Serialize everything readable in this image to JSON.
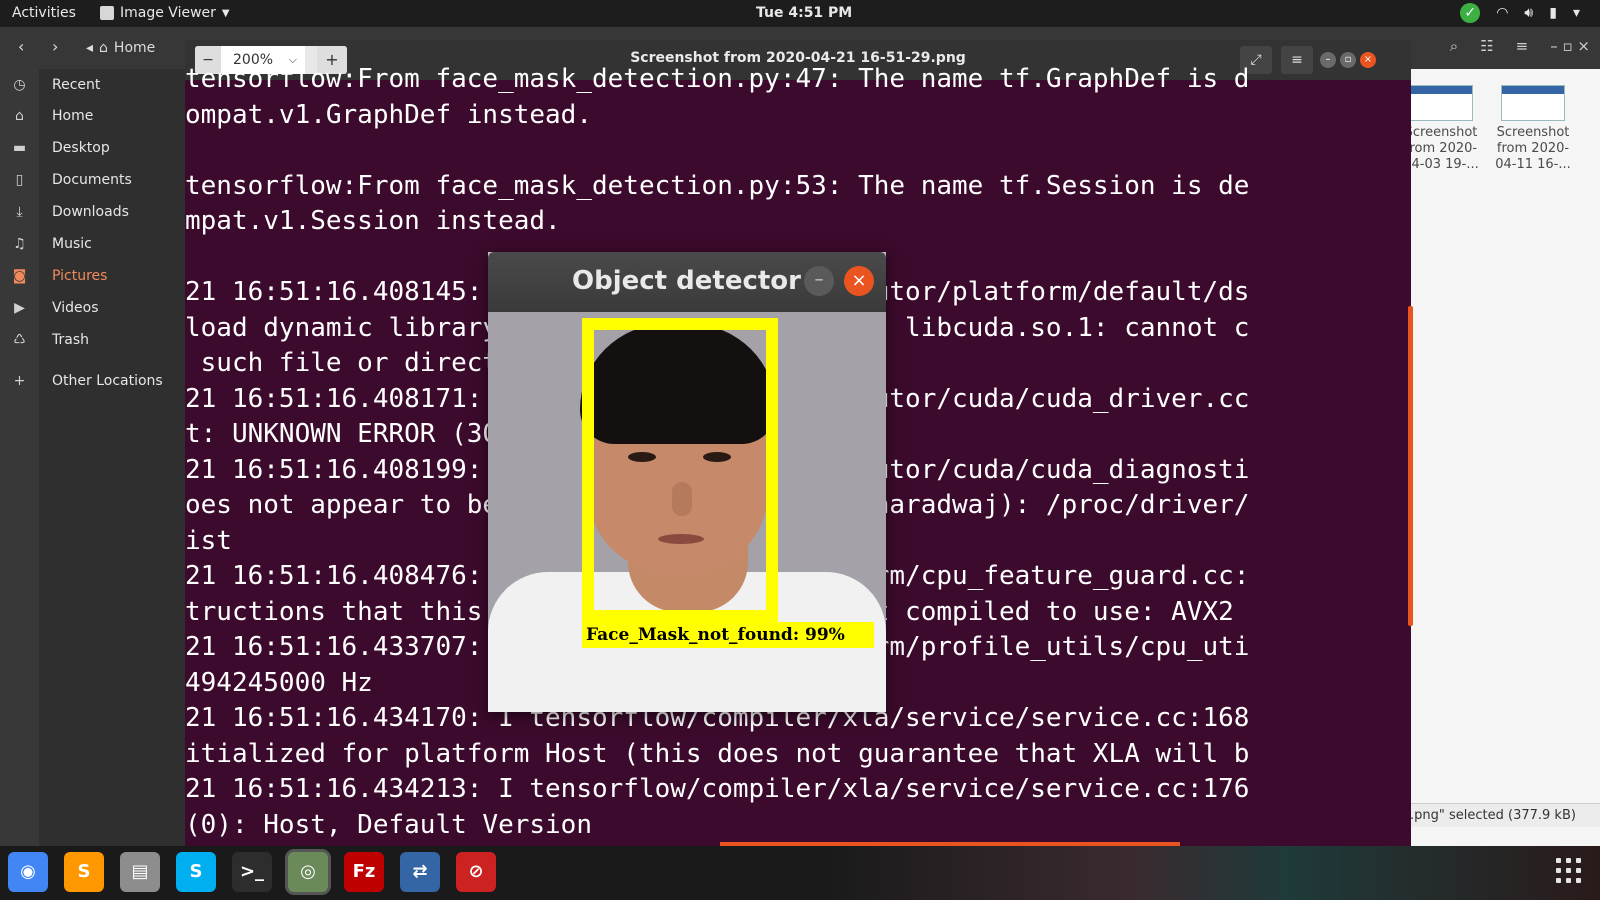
{
  "topbar": {
    "activities": "Activities",
    "app_menu": "Image Viewer",
    "clock": "Tue  4:51 PM"
  },
  "files": {
    "home_crumb": "Home",
    "sidebar": [
      {
        "label": "Recent",
        "icon": "clock-icon"
      },
      {
        "label": "Home",
        "icon": "home-icon"
      },
      {
        "label": "Desktop",
        "icon": "folder-icon"
      },
      {
        "label": "Documents",
        "icon": "document-icon"
      },
      {
        "label": "Downloads",
        "icon": "download-icon"
      },
      {
        "label": "Music",
        "icon": "music-icon"
      },
      {
        "label": "Pictures",
        "icon": "camera-icon"
      },
      {
        "label": "Videos",
        "icon": "video-icon"
      },
      {
        "label": "Trash",
        "icon": "trash-icon"
      },
      {
        "label": "Other Locations",
        "icon": "plus-icon"
      }
    ],
    "thumbnails": [
      {
        "label": "Screenshot from 2020-04-03 19-..."
      },
      {
        "label": "Screenshot from 2020-04-11 16-..."
      }
    ],
    "status": ".png\" selected  (377.9 kB)"
  },
  "viewer": {
    "zoom": "200%",
    "title": "Screenshot from 2020-04-21 16-51-29.png",
    "terminal_lines": [
      "tensorflow:From face_mask_detection.py:47: The name tf.GraphDef is d",
      "ompat.v1.GraphDef instead.",
      "",
      "tensorflow:From face_mask_detection.py:53: The name tf.Session is de",
      "mpat.v1.Session instead.",
      "",
      "21 16:51:16.408145: I tensorflow/stream_executor/platform/default/ds",
      "load dynamic library 'libcuda.so.1'; dlerror: libcuda.so.1: cannot c",
      " such file or directory",
      "21 16:51:16.408171: E tensorflow/stream_executor/cuda/cuda_driver.cc",
      "t: UNKNOWN ERROR (303)",
      "21 16:51:16.408199: I tensorflow/stream_executor/cuda/cuda_diagnosti",
      "oes not appear to be running on this host (Bharadwaj): /proc/driver/",
      "ist",
      "21 16:51:16.408476: I tensorflow/core/platform/cpu_feature_guard.cc:",
      "tructions that this TensorFlow binary was not compiled to use: AVX2 ",
      "21 16:51:16.433707: I tensorflow/core/platform/profile_utils/cpu_uti",
      "494245000 Hz",
      "21 16:51:16.434170: I tensorflow/compiler/xla/service/service.cc:168",
      "itialized for platform Host (this does not guarantee that XLA will b",
      "21 16:51:16.434213: I tensorflow/compiler/xla/service/service.cc:176",
      "(0): Host, Default Version"
    ]
  },
  "detector": {
    "title": "Object detector",
    "label": "Face_Mask_not_found: 99%"
  },
  "dock": [
    {
      "name": "chrome-icon",
      "color": "#4285f4",
      "glyph": "◉"
    },
    {
      "name": "sublime-text-icon",
      "color": "#ff9800",
      "glyph": "S"
    },
    {
      "name": "file-manager-icon",
      "color": "#8d8d8d",
      "glyph": "▤"
    },
    {
      "name": "skype-icon",
      "color": "#00aff0",
      "glyph": "S"
    },
    {
      "name": "terminal-icon",
      "color": "#2d2d2d",
      "glyph": ">_"
    },
    {
      "name": "image-viewer-icon",
      "color": "#6a8a5a",
      "glyph": "◎"
    },
    {
      "name": "filezilla-icon",
      "color": "#bf0000",
      "glyph": "Fz"
    },
    {
      "name": "network-tool-icon",
      "color": "#3465a4",
      "glyph": "⇄"
    },
    {
      "name": "red-app-icon",
      "color": "#cc2222",
      "glyph": "⊘"
    }
  ]
}
